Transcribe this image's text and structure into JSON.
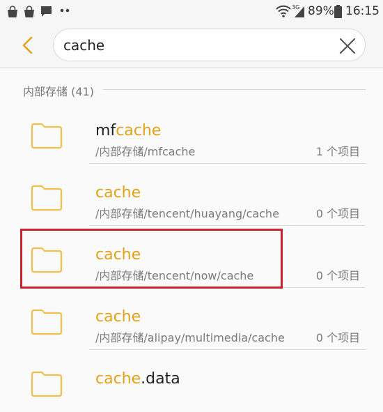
{
  "status_bar": {
    "battery": "89%",
    "time": "16:15",
    "network": "3G"
  },
  "search": {
    "query": "cache"
  },
  "section": {
    "title": "内部存储 (41)"
  },
  "results": [
    {
      "name_prefix": "mf",
      "name_match": "cache",
      "name_suffix": "",
      "path": "/内部存储/mfcache",
      "count": "1 个项目"
    },
    {
      "name_prefix": "",
      "name_match": "cache",
      "name_suffix": "",
      "path": "/内部存储/tencent/huayang/cache",
      "count": "0 个项目"
    },
    {
      "name_prefix": "",
      "name_match": "cache",
      "name_suffix": "",
      "path": "/内部存储/tencent/now/cache",
      "count": "0 个项目"
    },
    {
      "name_prefix": "",
      "name_match": "cache",
      "name_suffix": "",
      "path": "/内部存储/alipay/multimedia/cache",
      "count": "0 个项目"
    },
    {
      "name_prefix": "",
      "name_match": "cache",
      "name_suffix": ".data",
      "path": "",
      "count": ""
    }
  ],
  "colors": {
    "accent": "#e3a21a",
    "highlight_box": "#c8232c",
    "folder": "#f2c049"
  },
  "icons": [
    "shopping-bag-icon",
    "shopping-bag-icon",
    "message-icon",
    "more-dots-icon",
    "wifi-icon",
    "signal-icon",
    "battery-icon",
    "back-arrow-icon",
    "clear-icon",
    "folder-icon"
  ]
}
